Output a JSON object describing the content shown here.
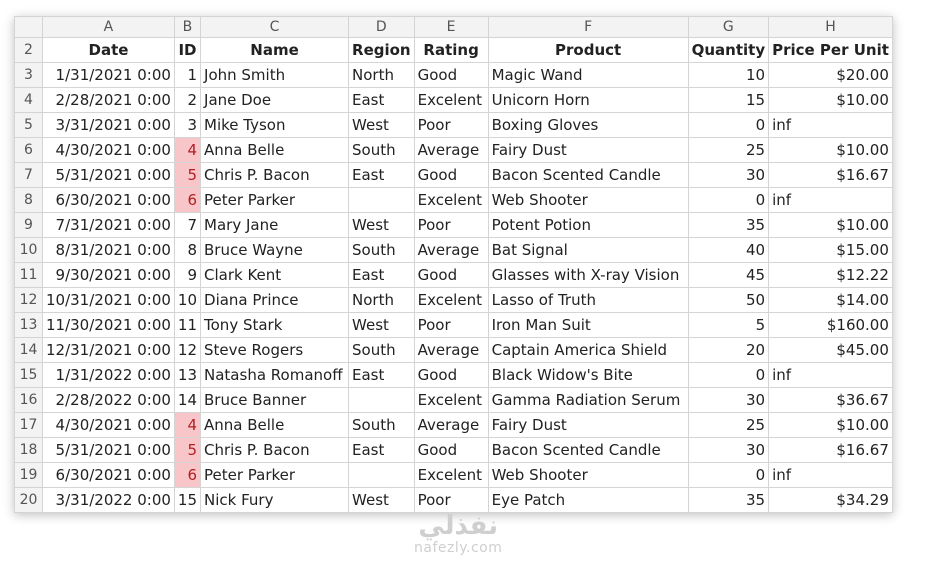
{
  "columns": [
    "A",
    "B",
    "C",
    "D",
    "E",
    "F",
    "G",
    "H"
  ],
  "header": {
    "row_num": "2",
    "cells": [
      "Date",
      "ID",
      "Name",
      "Region",
      "Rating",
      "Product",
      "Quantity",
      "Price Per Unit"
    ]
  },
  "rows": [
    {
      "n": "3",
      "date": "1/31/2021 0:00",
      "id": "1",
      "name": "John Smith",
      "region": "North",
      "rating": "Good",
      "product": "Magic Wand",
      "qty": "10",
      "price": "$20.00"
    },
    {
      "n": "4",
      "date": "2/28/2021 0:00",
      "id": "2",
      "name": "Jane Doe",
      "region": "East",
      "rating": "Excelent",
      "product": "Unicorn Horn",
      "qty": "15",
      "price": "$10.00"
    },
    {
      "n": "5",
      "date": "3/31/2021 0:00",
      "id": "3",
      "name": "Mike   Tyson",
      "region": "West",
      "rating": "Poor",
      "product": "Boxing Gloves",
      "qty": "0",
      "price": "inf"
    },
    {
      "n": "6",
      "date": "4/30/2021 0:00",
      "id": "4",
      "name": "Anna   Belle",
      "region": "South",
      "rating": "Average",
      "product": "Fairy Dust",
      "qty": "25",
      "price": "$10.00",
      "dup": true
    },
    {
      "n": "7",
      "date": "5/31/2021 0:00",
      "id": "5",
      "name": "Chris P. Bacon",
      "region": "East",
      "rating": "Good",
      "product": "Bacon Scented Candle",
      "qty": "30",
      "price": "$16.67",
      "dup": true
    },
    {
      "n": "8",
      "date": "6/30/2021 0:00",
      "id": "6",
      "name": "Peter   Parker",
      "region": "",
      "rating": "Excelent",
      "product": "Web Shooter",
      "qty": "0",
      "price": "inf",
      "dup": true
    },
    {
      "n": "9",
      "date": "7/31/2021 0:00",
      "id": "7",
      "name": "Mary Jane",
      "region": "West",
      "rating": "Poor",
      "product": "Potent Potion",
      "qty": "35",
      "price": "$10.00"
    },
    {
      "n": "10",
      "date": "8/31/2021 0:00",
      "id": "8",
      "name": "Bruce Wayne",
      "region": "South",
      "rating": "Average",
      "product": "Bat Signal",
      "qty": "40",
      "price": "$15.00"
    },
    {
      "n": "11",
      "date": "9/30/2021 0:00",
      "id": "9",
      "name": "Clark Kent",
      "region": "East",
      "rating": "Good",
      "product": "Glasses with X-ray Vision",
      "qty": "45",
      "price": "$12.22"
    },
    {
      "n": "12",
      "date": "10/31/2021 0:00",
      "id": "10",
      "name": "Diana Prince",
      "region": "North",
      "rating": "Excelent",
      "product": "Lasso of Truth",
      "qty": "50",
      "price": "$14.00"
    },
    {
      "n": "13",
      "date": "11/30/2021 0:00",
      "id": "11",
      "name": "Tony Stark",
      "region": "West",
      "rating": "Poor",
      "product": "Iron Man Suit",
      "qty": "5",
      "price": "$160.00"
    },
    {
      "n": "14",
      "date": "12/31/2021 0:00",
      "id": "12",
      "name": "Steve Rogers",
      "region": "South",
      "rating": "Average",
      "product": "Captain America Shield",
      "qty": "20",
      "price": "$45.00"
    },
    {
      "n": "15",
      "date": "1/31/2022 0:00",
      "id": "13",
      "name": "Natasha Romanoff",
      "region": "East",
      "rating": "Good",
      "product": "Black Widow's Bite",
      "qty": "0",
      "price": "inf"
    },
    {
      "n": "16",
      "date": "2/28/2022 0:00",
      "id": "14",
      "name": "Bruce Banner",
      "region": "",
      "rating": "Excelent",
      "product": "Gamma Radiation Serum",
      "qty": "30",
      "price": "$36.67"
    },
    {
      "n": "17",
      "date": "4/30/2021 0:00",
      "id": "4",
      "name": "Anna   Belle",
      "region": "South",
      "rating": "Average",
      "product": "Fairy Dust",
      "qty": "25",
      "price": "$10.00",
      "dup": true
    },
    {
      "n": "18",
      "date": "5/31/2021 0:00",
      "id": "5",
      "name": "Chris P. Bacon",
      "region": "East",
      "rating": "Good",
      "product": "Bacon Scented Candle",
      "qty": "30",
      "price": "$16.67",
      "dup": true
    },
    {
      "n": "19",
      "date": "6/30/2021 0:00",
      "id": "6",
      "name": "Peter   Parker",
      "region": "",
      "rating": "Excelent",
      "product": "Web Shooter",
      "qty": "0",
      "price": "inf",
      "dup": true
    },
    {
      "n": "20",
      "date": "3/31/2022 0:00",
      "id": "15",
      "name": "Nick Fury",
      "region": "West",
      "rating": "Poor",
      "product": "Eye Patch",
      "qty": "35",
      "price": "$34.29"
    }
  ],
  "colors": {
    "duplicate_fill": "#f8c6c9",
    "duplicate_text": "#b01e23"
  },
  "watermark": {
    "arabic": "نفذلي",
    "latin": "nafezly.com"
  }
}
